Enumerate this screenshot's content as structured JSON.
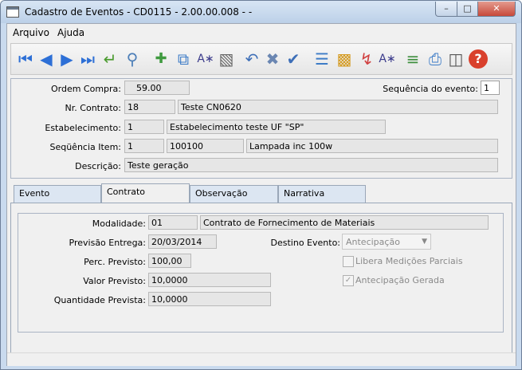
{
  "window": {
    "title": "Cadastro de Eventos - CD0115 - 2.00.00.008 -  -"
  },
  "menu": {
    "arquivo": "Arquivo",
    "ajuda": "Ajuda"
  },
  "toolbar": {
    "icons": [
      "first-record-icon",
      "previous-record-icon",
      "next-record-icon",
      "last-record-icon",
      "goto-return-icon",
      "zoom-search-icon",
      "add-record-icon",
      "copy-record-icon",
      "edit-record-icon",
      "delete-record-icon",
      "undo-icon",
      "cancel-icon",
      "confirm-icon",
      "tree-icon",
      "report-icon",
      "import-icon",
      "edit-document-icon",
      "list-tree-icon",
      "print-icon",
      "exit-icon",
      "help-icon"
    ]
  },
  "header": {
    "ordem_compra": {
      "label": "Ordem Compra:",
      "value": "59.00"
    },
    "sequencia_evento": {
      "label": "Sequência do evento:",
      "value": "1"
    },
    "nr_contrato": {
      "label": "Nr. Contrato:",
      "value": "18",
      "desc": "Teste CN0620"
    },
    "estabelecimento": {
      "label": "Estabelecimento:",
      "value": "1",
      "desc": "Estabelecimento teste UF \"SP\""
    },
    "sequencia_item": {
      "label": "Seqüência Item:",
      "value": "1",
      "code": "100100",
      "desc": "Lampada inc 100w"
    },
    "descricao": {
      "label": "Descrição:",
      "value": "Teste geração"
    }
  },
  "tabs": [
    "Evento",
    "Contrato",
    "Observação",
    "Narrativa"
  ],
  "contrato": {
    "modalidade": {
      "label": "Modalidade:",
      "value": "01",
      "desc": "Contrato de Fornecimento de Materiais"
    },
    "previsao_entrega": {
      "label": "Previsão Entrega:",
      "value": "20/03/2014"
    },
    "destino_evento": {
      "label": "Destino Evento:",
      "value": "Antecipação"
    },
    "perc_previsto": {
      "label": "Perc. Previsto:",
      "value": "100,00"
    },
    "libera_medicoes": {
      "label": "Libera Medições Parciais",
      "checked": false
    },
    "valor_previsto": {
      "label": "Valor Previsto:",
      "value": "10,0000"
    },
    "antecipacao_gerada": {
      "label": "Antecipação Gerada",
      "checked": true
    },
    "quantidade_prevista": {
      "label": "Quantidade Prevista:",
      "value": "10,0000"
    }
  }
}
